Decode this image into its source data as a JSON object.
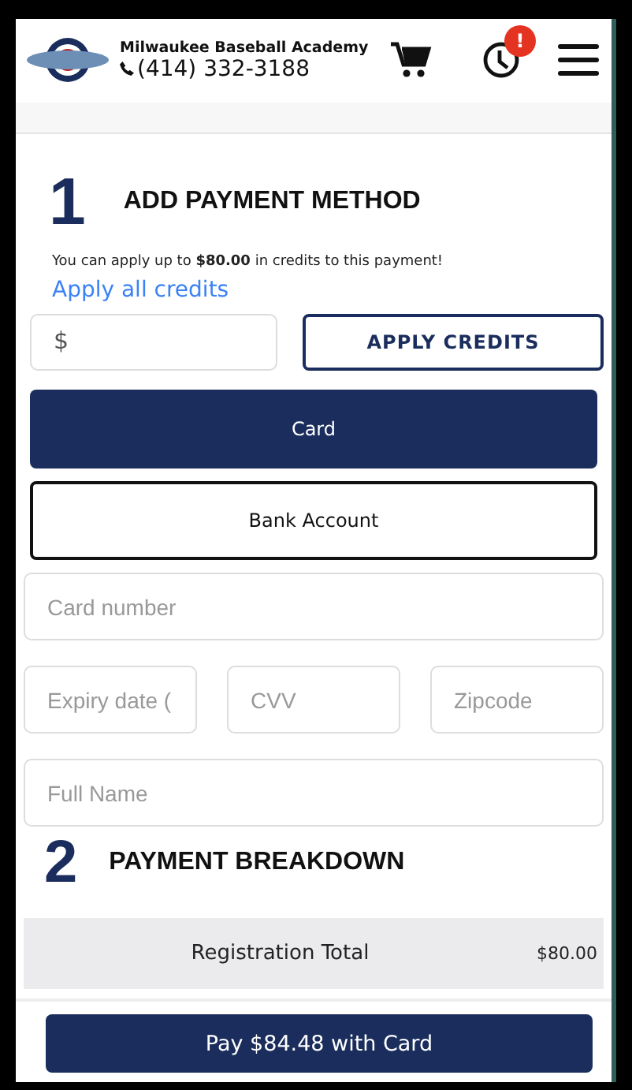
{
  "header": {
    "academy_name": "Milwaukee Baseball Academy",
    "phone": "(414) 332-3188",
    "notification_badge": "!"
  },
  "step_1": {
    "number": "1",
    "title": "ADD PAYMENT METHOD",
    "credit_note": "You can apply up to **$80.00** in credits to this payment!",
    "apply_all_link": "Apply all credits",
    "credit_field": {
      "placeholder": "$"
    },
    "apply_button": "APPLY CREDITS",
    "methods": [
      {
        "label": "Card",
        "selected": true
      },
      {
        "label": "Bank Account",
        "selected": false
      }
    ],
    "card_fields": [
      {
        "placeholder": "Card number"
      },
      {
        "placeholder": "Expiry date ("
      },
      {
        "placeholder": "CVV"
      },
      {
        "placeholder": "Zipcode"
      },
      {
        "placeholder": "Full Name"
      }
    ]
  },
  "step_2": {
    "number": "2",
    "title": "PAYMENT BREAKDOWN",
    "rows": [
      {
        "label": "Registration Total",
        "amount": "$80.00"
      }
    ]
  },
  "pay_button": "Pay $84.48 with Card"
}
